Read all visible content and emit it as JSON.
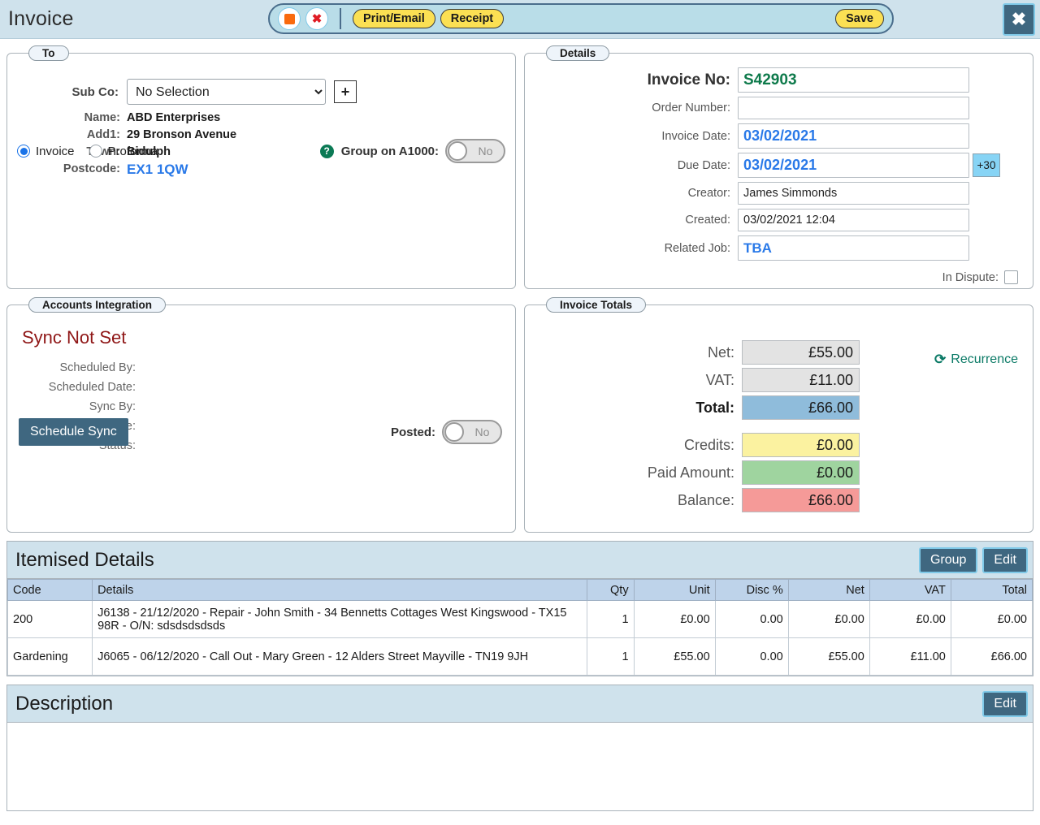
{
  "header": {
    "title": "Invoice",
    "stop_icon": "stop-square-icon",
    "cancel_icon": "cancel-x-icon",
    "print_email_label": "Print/Email",
    "receipt_label": "Receipt",
    "save_label": "Save",
    "close_icon": "close-x-icon"
  },
  "to": {
    "legend": "To",
    "subco_label": "Sub Co:",
    "subco_value": "No Selection",
    "add_label": "+",
    "fields": [
      {
        "label": "Name:",
        "value": "ABD Enterprises"
      },
      {
        "label": "Add1:",
        "value": "29 Bronson Avenue"
      },
      {
        "label": "Town:",
        "value": "Bidulph"
      },
      {
        "label": "Postcode:",
        "value": "EX1 1QW"
      }
    ],
    "radio_invoice": "Invoice",
    "radio_proforma": "Proforma",
    "help_icon": "help-question-icon",
    "group_label": "Group on A1000:",
    "group_value": "No"
  },
  "details": {
    "legend": "Details",
    "invoice_no_label": "Invoice No:",
    "invoice_no_value": "S42903",
    "order_number_label": "Order Number:",
    "order_number_value": "",
    "invoice_date_label": "Invoice Date:",
    "invoice_date_value": "03/02/2021",
    "due_date_label": "Due Date:",
    "due_date_value": "03/02/2021",
    "plus30_label": "+30",
    "creator_label": "Creator:",
    "creator_value": "James Simmonds",
    "created_label": "Created:",
    "created_value": "03/02/2021  12:04",
    "related_job_label": "Related Job:",
    "related_job_value": "TBA",
    "in_dispute_label": "In Dispute:"
  },
  "accounts": {
    "legend": "Accounts Integration",
    "status_title": "Sync Not Set",
    "rows": [
      {
        "label": "Scheduled By:",
        "value": ""
      },
      {
        "label": "Scheduled Date:",
        "value": ""
      },
      {
        "label": "Sync By:",
        "value": ""
      },
      {
        "label": "Sync Date:",
        "value": ""
      },
      {
        "label": "Status:",
        "value": ""
      }
    ],
    "schedule_button": "Schedule Sync",
    "posted_label": "Posted:",
    "posted_value": "No"
  },
  "totals": {
    "legend": "Invoice Totals",
    "recurrence_label": "Recurrence",
    "recurrence_icon": "refresh-recurrence-icon",
    "rows": [
      {
        "label": "Net:",
        "value": "£55.00"
      },
      {
        "label": "VAT:",
        "value": "£11.00"
      },
      {
        "label": "Total:",
        "value": "£66.00"
      },
      {
        "label": "Credits:",
        "value": "£0.00"
      },
      {
        "label": "Paid Amount:",
        "value": "£0.00"
      },
      {
        "label": "Balance:",
        "value": "£66.00"
      }
    ]
  },
  "itemised": {
    "title": "Itemised Details",
    "group_label": "Group",
    "edit_label": "Edit",
    "columns": [
      "Code",
      "Details",
      "Qty",
      "Unit",
      "Disc %",
      "Net",
      "VAT",
      "Total"
    ],
    "rows": [
      {
        "code": "200",
        "details": "J6138 - 21/12/2020 - Repair - John Smith - 34 Bennetts Cottages West Kingswood - TX15 98R - O/N: sdsdsdsdsds",
        "qty": "1",
        "unit": "£0.00",
        "disc": "0.00",
        "net": "£0.00",
        "vat": "£0.00",
        "total": "£0.00"
      },
      {
        "code": "Gardening",
        "details": "J6065 - 06/12/2020 - Call Out - Mary Green - 12 Alders Street Mayville - TN19 9JH",
        "qty": "1",
        "unit": "£55.00",
        "disc": "0.00",
        "net": "£55.00",
        "vat": "£11.00",
        "total": "£66.00"
      }
    ]
  },
  "description": {
    "title": "Description",
    "edit_label": "Edit",
    "body": ""
  },
  "colors": {
    "header_bg": "#cfe2ec",
    "accent_dark": "#3f6780",
    "accent_cyan": "#7fc9e8",
    "yellow_button": "#fbe053",
    "total_blue": "#8fbcdb",
    "credits_yellow": "#fbf2a0",
    "paid_green": "#9fd49f",
    "balance_red": "#f59a98",
    "invoice_no_green": "#0e7a4b",
    "date_blue": "#2979e8",
    "sync_red": "#8f1616",
    "recurrence_teal": "#0b7a66"
  }
}
